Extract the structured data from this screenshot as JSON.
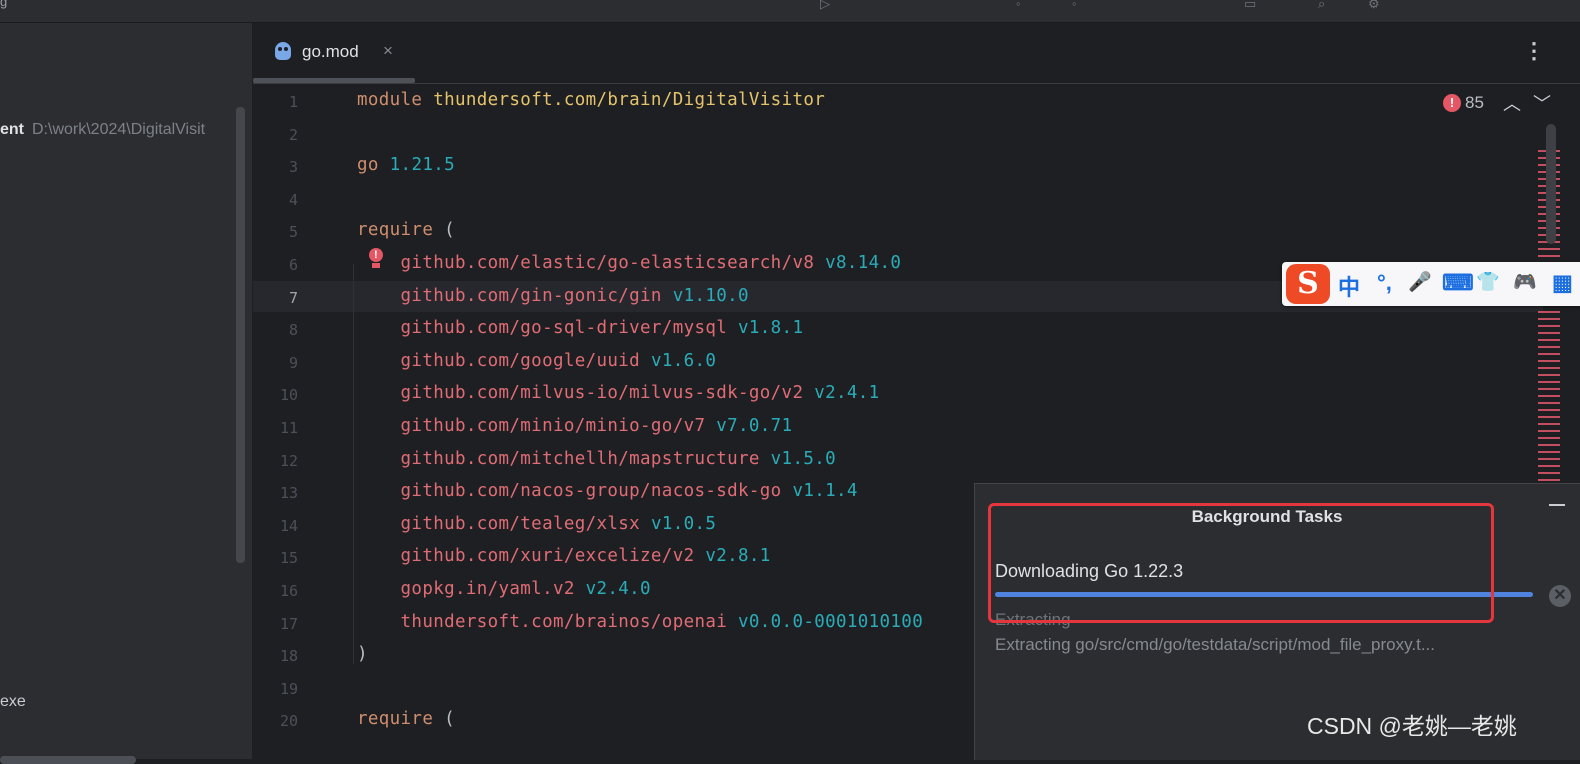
{
  "titlebar": {
    "frag": "g"
  },
  "project": {
    "item_bold": "ent",
    "item_path": "D:\\work\\2024\\DigitalVisit",
    "exe": "exe"
  },
  "tab": {
    "label": "go.mod",
    "close": "×",
    "more": "⋮"
  },
  "editor": {
    "error_count": "85",
    "active_line": "7",
    "lines": [
      {
        "n": "1",
        "parts": [
          [
            "kw",
            "module"
          ],
          [
            "plain",
            " "
          ],
          [
            "path",
            "thundersoft.com/brain/DigitalVisitor"
          ]
        ]
      },
      {
        "n": "2",
        "parts": []
      },
      {
        "n": "3",
        "parts": [
          [
            "kw",
            "go"
          ],
          [
            "plain",
            " "
          ],
          [
            "ver",
            "1.21.5"
          ]
        ]
      },
      {
        "n": "4",
        "parts": []
      },
      {
        "n": "5",
        "parts": [
          [
            "kw",
            "require"
          ],
          [
            "plain",
            " ("
          ]
        ]
      },
      {
        "n": "6",
        "parts": [
          [
            "plain",
            "    "
          ],
          [
            "dep-path",
            "github.com/elastic/go-elasticsearch/v8"
          ],
          [
            "plain",
            " "
          ],
          [
            "dep-ver",
            "v8.14.0"
          ]
        ]
      },
      {
        "n": "7",
        "parts": [
          [
            "plain",
            "    "
          ],
          [
            "dep-path",
            "github.com/gin-gonic/gin"
          ],
          [
            "plain",
            " "
          ],
          [
            "dep-ver",
            "v1.10.0"
          ]
        ]
      },
      {
        "n": "8",
        "parts": [
          [
            "plain",
            "    "
          ],
          [
            "dep-path",
            "github.com/go-sql-driver/mysql"
          ],
          [
            "plain",
            " "
          ],
          [
            "dep-ver",
            "v1.8.1"
          ]
        ]
      },
      {
        "n": "9",
        "parts": [
          [
            "plain",
            "    "
          ],
          [
            "dep-path",
            "github.com/google/uuid"
          ],
          [
            "plain",
            " "
          ],
          [
            "dep-ver",
            "v1.6.0"
          ]
        ]
      },
      {
        "n": "10",
        "parts": [
          [
            "plain",
            "    "
          ],
          [
            "dep-path",
            "github.com/milvus-io/milvus-sdk-go/v2"
          ],
          [
            "plain",
            " "
          ],
          [
            "dep-ver",
            "v2.4.1"
          ]
        ]
      },
      {
        "n": "11",
        "parts": [
          [
            "plain",
            "    "
          ],
          [
            "dep-path",
            "github.com/minio/minio-go/v7"
          ],
          [
            "plain",
            " "
          ],
          [
            "dep-ver",
            "v7.0.71"
          ]
        ]
      },
      {
        "n": "12",
        "parts": [
          [
            "plain",
            "    "
          ],
          [
            "dep-path",
            "github.com/mitchellh/mapstructure"
          ],
          [
            "plain",
            " "
          ],
          [
            "dep-ver",
            "v1.5.0"
          ]
        ]
      },
      {
        "n": "13",
        "parts": [
          [
            "plain",
            "    "
          ],
          [
            "dep-path",
            "github.com/nacos-group/nacos-sdk-go"
          ],
          [
            "plain",
            " "
          ],
          [
            "dep-ver",
            "v1.1.4"
          ]
        ]
      },
      {
        "n": "14",
        "parts": [
          [
            "plain",
            "    "
          ],
          [
            "dep-path",
            "github.com/tealeg/xlsx"
          ],
          [
            "plain",
            " "
          ],
          [
            "dep-ver",
            "v1.0.5"
          ]
        ]
      },
      {
        "n": "15",
        "parts": [
          [
            "plain",
            "    "
          ],
          [
            "dep-path",
            "github.com/xuri/excelize/v2"
          ],
          [
            "plain",
            " "
          ],
          [
            "dep-ver",
            "v2.8.1"
          ]
        ]
      },
      {
        "n": "16",
        "parts": [
          [
            "plain",
            "    "
          ],
          [
            "dep-path",
            "gopkg.in/yaml.v2"
          ],
          [
            "plain",
            " "
          ],
          [
            "dep-ver",
            "v2.4.0"
          ]
        ]
      },
      {
        "n": "17",
        "parts": [
          [
            "plain",
            "    "
          ],
          [
            "dep-path",
            "thundersoft.com/brainos/openai"
          ],
          [
            "plain",
            " "
          ],
          [
            "dep-ver",
            "v0.0.0-0001010100"
          ]
        ]
      },
      {
        "n": "18",
        "parts": [
          [
            "plain",
            ")"
          ]
        ]
      },
      {
        "n": "19",
        "parts": []
      },
      {
        "n": "20",
        "parts": [
          [
            "kw",
            "require"
          ],
          [
            "plain",
            " ("
          ]
        ]
      }
    ]
  },
  "ime": {
    "logo": "S",
    "lang": "中",
    "punct": "°,",
    "mic": "🎤",
    "keyboard": "⌨",
    "shirt": "👕",
    "game": "🎮",
    "grid": "▦"
  },
  "background_tasks": {
    "title": "Background Tasks",
    "task": "Downloading Go 1.22.3",
    "progress": 1.0,
    "status": "Extracting",
    "detail": "Extracting go/src/cmd/go/testdata/script/mod_file_proxy.t...",
    "cancel": "✕"
  },
  "watermark": "CSDN @老姚—老姚",
  "colors": {
    "accent": "#4f83de",
    "error": "#e55765",
    "highlight_box": "#e5353d"
  }
}
